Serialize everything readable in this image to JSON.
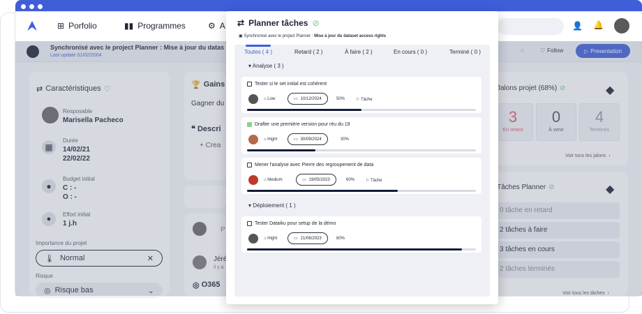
{
  "nav": {
    "items": [
      "Porfolio",
      "Programmes",
      "A"
    ]
  },
  "sub": {
    "project_title": "Synchronisé avec le project Planner : Mise à jour du datas",
    "last_update": "Last update 01/02/2004",
    "follow": "Follow",
    "presentation": "Presentation"
  },
  "left": {
    "header": "Caractéristiques",
    "responsable_label": "Resposable",
    "responsable_value": "Marisella Pacheco",
    "duree_label": "Durée",
    "duree_start": "14/02/21",
    "duree_end": "22/02/22",
    "budget_label": "Budget initial",
    "budget_c": "C : -",
    "budget_o": "O : -",
    "effort_label": "Effort initial",
    "effort_value": "1 j.h",
    "importance_label": "Importance du projet",
    "importance_value": "Normal",
    "risque_label": "Risque",
    "risque_value": "Risque bas"
  },
  "middle": {
    "gains_title": "Gains",
    "gains_text": "Gagner du",
    "descr_title": "Descri",
    "create_label": "+ Crea",
    "commenter_initial": "P",
    "commenter_name": "Jéré",
    "commenter_time": "il y a",
    "o365": "O365"
  },
  "modal": {
    "title": "Planner tâches",
    "sync_prefix": "Synchronisé avec le project Planner : ",
    "sync_bold": "Mise à jour du dataset access rights",
    "tabs": [
      "Toutes ( 4 )",
      "Retard ( 2 )",
      "À faire ( 2 )",
      "En cours ( 0 )",
      "Terminé ( 0 )"
    ],
    "groups": [
      {
        "label": "Analyse ( 3 )"
      },
      {
        "label": "Déploiement ( 1 )"
      }
    ],
    "tasks": [
      {
        "title": "Tester si le set initial est cohérent",
        "priority": "Low",
        "date": "10/12/2024",
        "pct": "50%",
        "tag": "Tâche",
        "progress": 0.5,
        "done": false
      },
      {
        "title": "Drafter une première version pour réu du 19",
        "priority": "Hight",
        "date": "30/09/2024",
        "pct": "30%",
        "tag": "",
        "progress": 0.3,
        "done": true
      },
      {
        "title": "Mener l'analyse avec Pierre des regroupement de data",
        "priority": "Medium",
        "date": "19/05/2023",
        "pct": "60%",
        "tag": "Tâche",
        "progress": 0.66,
        "done": false
      },
      {
        "title": "Tester Dataiku pour setup de la démo",
        "priority": "Hight",
        "date": "21/06/2023",
        "pct": "80%",
        "tag": "",
        "progress": 0.94,
        "done": false
      }
    ]
  },
  "right": {
    "jalons_title": "Jalons projet (68%)",
    "stats": [
      {
        "n": "3",
        "s": "En retard"
      },
      {
        "n": "0",
        "s": "À venir"
      },
      {
        "n": "4",
        "s": "Terminés"
      }
    ],
    "voir_jalons": "Voir tous les jalons",
    "planner_title": "Tâches Planner",
    "planner_rows": [
      "0 tâche en retard",
      "2 tâches à faire",
      "3 tâches en cours",
      "2 tâches terminés"
    ],
    "voir_taches": "Voir tous les tâches"
  },
  "colors": {
    "accent": "#3f5ed8",
    "late": "#e05a6a",
    "done": "#7cc47c",
    "dark": "#141c3a"
  }
}
